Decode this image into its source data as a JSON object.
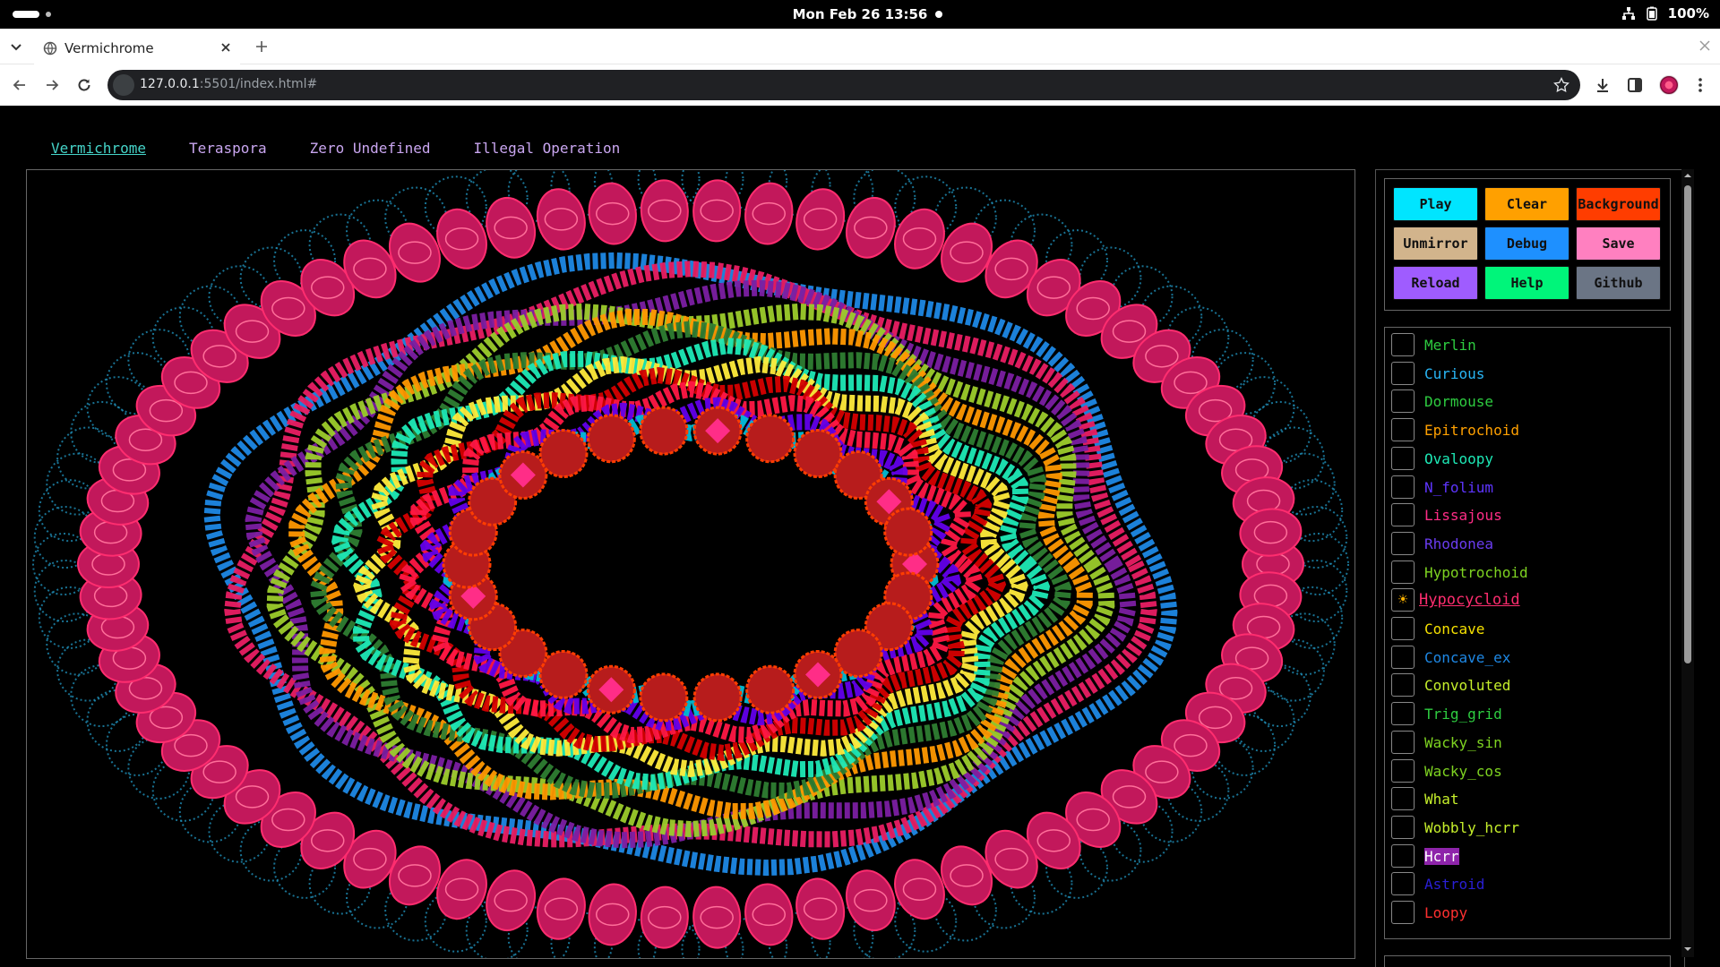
{
  "os": {
    "clock": "Mon Feb 26  13:56",
    "battery": "100%"
  },
  "browser": {
    "tab_title": "Vermichrome",
    "url_host": "127.0.0.1",
    "url_rest": ":5501/index.html#"
  },
  "site_nav": [
    "Vermichrome",
    "Teraspora",
    "Zero Undefined",
    "Illegal Operation"
  ],
  "buttons": [
    {
      "label": "Play",
      "color": "#00e5ff"
    },
    {
      "label": "Clear",
      "color": "#ffa000"
    },
    {
      "label": "Background",
      "color": "#ff3d00"
    },
    {
      "label": "Unmirror",
      "color": "#d2b48c"
    },
    {
      "label": "Debug",
      "color": "#1e90ff"
    },
    {
      "label": "Save",
      "color": "#ff80c0"
    },
    {
      "label": "Reload",
      "color": "#9f5cff"
    },
    {
      "label": "Help",
      "color": "#00f57a"
    },
    {
      "label": "Github",
      "color": "#6b7585"
    }
  ],
  "patterns": [
    {
      "label": "Merlin",
      "color": "#2ecc40"
    },
    {
      "label": "Curious",
      "color": "#29b6f6"
    },
    {
      "label": "Dormouse",
      "color": "#2ecc40"
    },
    {
      "label": "Epitrochoid",
      "color": "#ffa000"
    },
    {
      "label": "Ovaloopy",
      "color": "#1de9b6"
    },
    {
      "label": "N_folium",
      "color": "#5e35ff"
    },
    {
      "label": "Lissajous",
      "color": "#ff2d87"
    },
    {
      "label": "Rhodonea",
      "color": "#6a3cf0"
    },
    {
      "label": "Hypotrochoid",
      "color": "#7ed321"
    },
    {
      "label": "Hypocycloid",
      "color": "#ff2d6f",
      "checked": true
    },
    {
      "label": "Concave",
      "color": "#f5e000"
    },
    {
      "label": "Concave_ex",
      "color": "#1e88e5"
    },
    {
      "label": "Convoluted",
      "color": "#c6ef2b"
    },
    {
      "label": "Trig_grid",
      "color": "#2ecc40"
    },
    {
      "label": "Wacky_sin",
      "color": "#7ed321"
    },
    {
      "label": "Wacky_cos",
      "color": "#7ed321"
    },
    {
      "label": "What",
      "color": "#c6ef2b"
    },
    {
      "label": "Wobbly_hcrr",
      "color": "#c6ef2b"
    },
    {
      "label": "Hcrr",
      "color": "#ffffff",
      "bg": "#8e24aa"
    },
    {
      "label": "Astroid",
      "color": "#2a1fd6"
    },
    {
      "label": "Loopy",
      "color": "#ff3030"
    }
  ]
}
